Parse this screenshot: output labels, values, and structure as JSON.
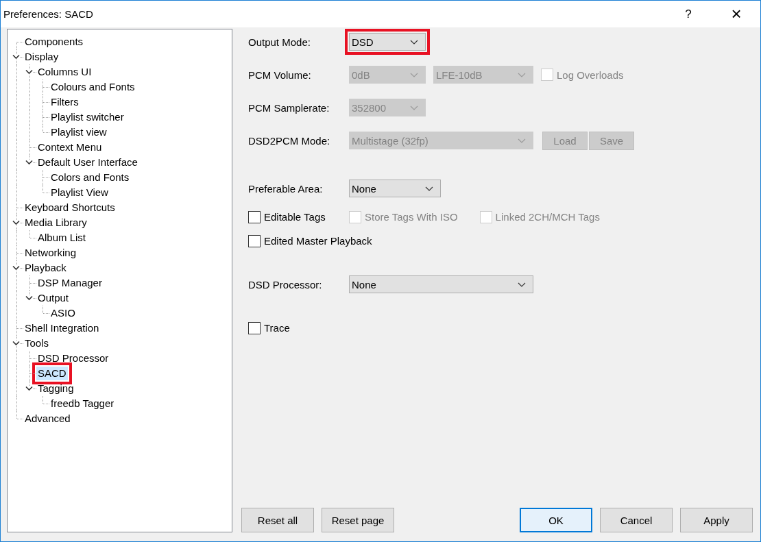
{
  "window": {
    "title": "Preferences: SACD",
    "help_button": "?",
    "close_button": "×"
  },
  "tree": {
    "items": [
      {
        "label": "Components",
        "selected": false,
        "annotated": false
      },
      {
        "label": "Display",
        "selected": false,
        "annotated": false,
        "expanded": true,
        "children": [
          {
            "label": "Columns UI",
            "selected": false,
            "annotated": false,
            "expanded": true,
            "children": [
              {
                "label": "Colours and Fonts",
                "selected": false,
                "annotated": false
              },
              {
                "label": "Filters",
                "selected": false,
                "annotated": false
              },
              {
                "label": "Playlist switcher",
                "selected": false,
                "annotated": false
              },
              {
                "label": "Playlist view",
                "selected": false,
                "annotated": false
              }
            ]
          },
          {
            "label": "Context Menu",
            "selected": false,
            "annotated": false
          },
          {
            "label": "Default User Interface",
            "selected": false,
            "annotated": false,
            "expanded": true,
            "children": [
              {
                "label": "Colors and Fonts",
                "selected": false,
                "annotated": false
              },
              {
                "label": "Playlist View",
                "selected": false,
                "annotated": false
              }
            ]
          }
        ]
      },
      {
        "label": "Keyboard Shortcuts",
        "selected": false,
        "annotated": false
      },
      {
        "label": "Media Library",
        "selected": false,
        "annotated": false,
        "expanded": true,
        "children": [
          {
            "label": "Album List",
            "selected": false,
            "annotated": false
          }
        ]
      },
      {
        "label": "Networking",
        "selected": false,
        "annotated": false
      },
      {
        "label": "Playback",
        "selected": false,
        "annotated": false,
        "expanded": true,
        "children": [
          {
            "label": "DSP Manager",
            "selected": false,
            "annotated": false
          },
          {
            "label": "Output",
            "selected": false,
            "annotated": false,
            "expanded": true,
            "children": [
              {
                "label": "ASIO",
                "selected": false,
                "annotated": false
              }
            ]
          }
        ]
      },
      {
        "label": "Shell Integration",
        "selected": false,
        "annotated": false
      },
      {
        "label": "Tools",
        "selected": false,
        "annotated": false,
        "expanded": true,
        "children": [
          {
            "label": "DSD Processor",
            "selected": false,
            "annotated": false
          },
          {
            "label": "SACD",
            "selected": true,
            "annotated": true
          },
          {
            "label": "Tagging",
            "selected": false,
            "annotated": false,
            "expanded": true,
            "children": [
              {
                "label": "freedb Tagger",
                "selected": false,
                "annotated": false
              }
            ]
          }
        ]
      },
      {
        "label": "Advanced",
        "selected": false,
        "annotated": false
      }
    ]
  },
  "form": {
    "groups": [
      {
        "rows": [
          {
            "kind": "fields",
            "label": "Output Mode:",
            "controls": [
              {
                "kind": "select",
                "value": "DSD",
                "disabled": false,
                "annotated": true
              }
            ]
          },
          {
            "kind": "fields",
            "label": "PCM Volume:",
            "controls": [
              {
                "kind": "select",
                "value": "0dB",
                "disabled": true,
                "annotated": false
              },
              {
                "kind": "select",
                "value": "LFE-10dB",
                "disabled": true,
                "annotated": false
              },
              {
                "kind": "checkbox",
                "label": "Log Overloads",
                "checked": false,
                "disabled": true
              }
            ]
          },
          {
            "kind": "fields",
            "label": "PCM Samplerate:",
            "controls": [
              {
                "kind": "select",
                "value": "352800",
                "disabled": true,
                "annotated": false
              }
            ]
          },
          {
            "kind": "fields",
            "label": "DSD2PCM Mode:",
            "controls": [
              {
                "kind": "select",
                "value": "Multistage (32fp)",
                "disabled": true,
                "annotated": false
              },
              {
                "kind": "button",
                "label": "Load",
                "disabled": true
              },
              {
                "kind": "button",
                "label": "Save",
                "disabled": true
              }
            ]
          }
        ]
      },
      {
        "rows": [
          {
            "kind": "fields",
            "label": "Preferable Area:",
            "controls": [
              {
                "kind": "select",
                "value": "None",
                "disabled": false,
                "annotated": false
              }
            ]
          },
          {
            "kind": "checks",
            "controls": [
              {
                "kind": "checkbox",
                "label": "Editable Tags",
                "checked": false,
                "disabled": false
              },
              {
                "kind": "checkbox",
                "label": "Store Tags With ISO",
                "checked": false,
                "disabled": true
              },
              {
                "kind": "checkbox",
                "label": "Linked 2CH/MCH Tags",
                "checked": false,
                "disabled": true
              }
            ]
          },
          {
            "kind": "checks",
            "controls": [
              {
                "kind": "checkbox",
                "label": "Edited Master Playback",
                "checked": false,
                "disabled": false
              }
            ]
          }
        ]
      },
      {
        "rows": [
          {
            "kind": "fields",
            "label": "DSD Processor:",
            "controls": [
              {
                "kind": "select",
                "value": "None",
                "disabled": false,
                "annotated": false
              }
            ]
          }
        ]
      },
      {
        "rows": [
          {
            "kind": "checks",
            "controls": [
              {
                "kind": "checkbox",
                "label": "Trace",
                "checked": false,
                "disabled": false
              }
            ]
          }
        ]
      }
    ]
  },
  "buttons": {
    "left": [
      {
        "label": "Reset all",
        "default": false
      },
      {
        "label": "Reset page",
        "default": false
      }
    ],
    "right": [
      {
        "label": "OK",
        "default": true
      },
      {
        "label": "Cancel",
        "default": false
      },
      {
        "label": "Apply",
        "default": false
      }
    ]
  }
}
